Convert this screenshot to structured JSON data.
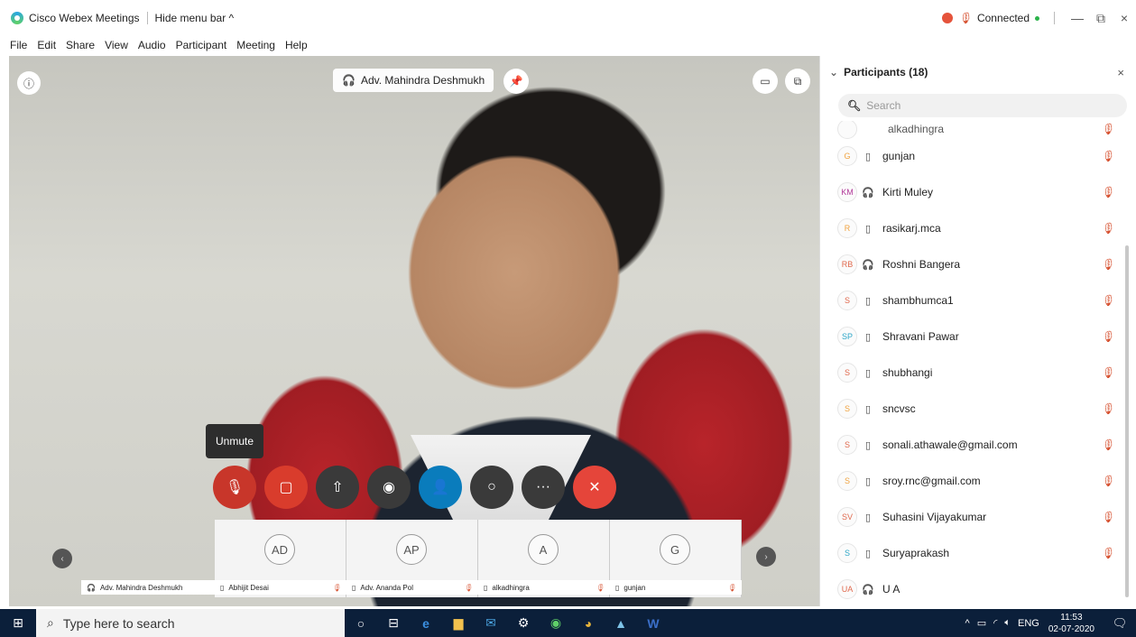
{
  "titlebar": {
    "app_name": "Cisco Webex Meetings",
    "hide_menu": "Hide menu bar ^",
    "status": "Connected",
    "minimize": "—",
    "maximize": "⧉",
    "close": "×"
  },
  "menu": [
    "File",
    "Edit",
    "Share",
    "View",
    "Audio",
    "Participant",
    "Meeting",
    "Help"
  ],
  "video": {
    "active_speaker": "Adv. Mahindra Deshmukh",
    "tooltip": "Unmute"
  },
  "controls": [
    {
      "name": "mute-button",
      "icon": "mic-off-icon",
      "glyph": "🎙",
      "color": "#c8362a"
    },
    {
      "name": "video-button",
      "icon": "video-off-icon",
      "glyph": "▢",
      "color": "#d93c2c"
    },
    {
      "name": "share-button",
      "icon": "share-icon",
      "glyph": "⇧",
      "color": "#3a3a3a"
    },
    {
      "name": "record-button",
      "icon": "record-icon",
      "glyph": "◉",
      "color": "#3a3a3a"
    },
    {
      "name": "participants-button",
      "icon": "participants-icon",
      "glyph": "👤",
      "color": "#0a7cbc"
    },
    {
      "name": "chat-button",
      "icon": "chat-icon",
      "glyph": "○",
      "color": "#3a3a3a"
    },
    {
      "name": "more-button",
      "icon": "more-icon",
      "glyph": "···",
      "color": "#3a3a3a"
    },
    {
      "name": "leave-button",
      "icon": "close-icon",
      "glyph": "✕",
      "color": "#e5453a"
    }
  ],
  "thumbnails": [
    {
      "initials": "AD",
      "name": "Abhijit Desai"
    },
    {
      "initials": "AP",
      "name": "Adv. Ananda Pol"
    },
    {
      "initials": "A",
      "name": "alkadhingra"
    },
    {
      "initials": "G",
      "name": "gunjan"
    }
  ],
  "strip_first_label": "Adv. Mahindra Deshmukh",
  "panel": {
    "title": "Participants (18)",
    "search_placeholder": "Search",
    "partial_top": "alkadhingra",
    "participants": [
      {
        "initials": "G",
        "name": "gunjan",
        "device": "phone",
        "color": "#f0a341"
      },
      {
        "initials": "KM",
        "name": "Kirti Muley",
        "device": "headset",
        "color": "#b23a9a"
      },
      {
        "initials": "R",
        "name": "rasikarj.mca",
        "device": "phone",
        "color": "#f0a341"
      },
      {
        "initials": "RB",
        "name": "Roshni Bangera",
        "device": "headset",
        "color": "#e06a4e"
      },
      {
        "initials": "S",
        "name": "shambhumca1",
        "device": "phone",
        "color": "#e06a4e"
      },
      {
        "initials": "SP",
        "name": "Shravani Pawar",
        "device": "phone",
        "color": "#2fa7c8"
      },
      {
        "initials": "S",
        "name": "shubhangi",
        "device": "phone",
        "color": "#e06a4e"
      },
      {
        "initials": "S",
        "name": "sncvsc",
        "device": "phone",
        "color": "#f0a341"
      },
      {
        "initials": "S",
        "name": "sonali.athawale@gmail.com",
        "device": "phone",
        "color": "#e06a4e"
      },
      {
        "initials": "S",
        "name": "sroy.rnc@gmail.com",
        "device": "phone",
        "color": "#f0a341"
      },
      {
        "initials": "SV",
        "name": "Suhasini  Vijayakumar",
        "device": "phone",
        "color": "#e06a4e"
      },
      {
        "initials": "S",
        "name": "Suryaprakash",
        "device": "phone",
        "color": "#2fa7c8"
      },
      {
        "initials": "UA",
        "name": "U A",
        "device": "headset",
        "color": "#e06a4e"
      }
    ]
  },
  "taskbar": {
    "search_placeholder": "Type here to search",
    "lang": "ENG",
    "time": "11:53",
    "date": "02-07-2020"
  }
}
